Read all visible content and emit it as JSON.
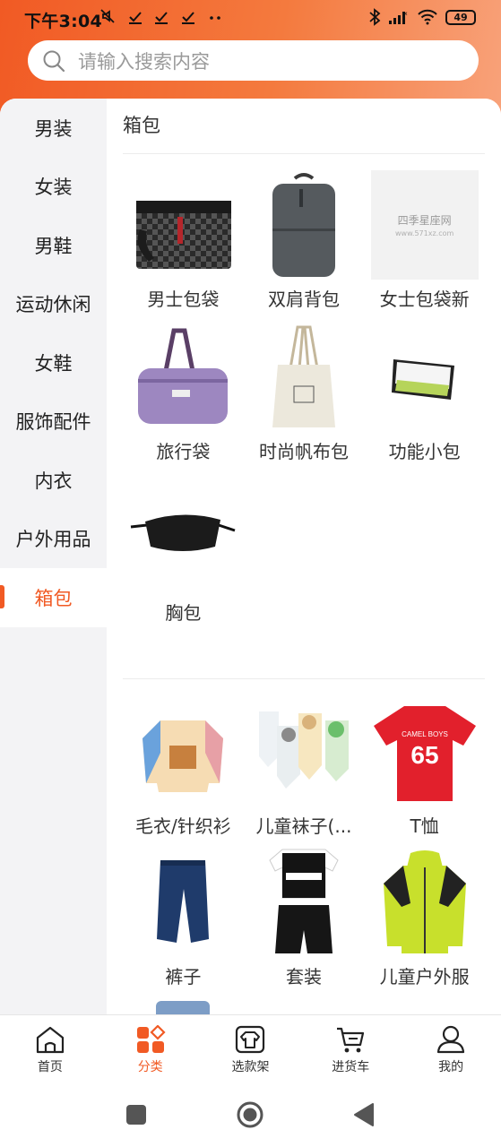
{
  "status_bar": {
    "time": "下午3:04",
    "left_icons": [
      "mute-icon",
      "check-icon",
      "check-icon",
      "check-icon",
      "more-dots-icon"
    ],
    "right_icons": [
      "bluetooth-icon",
      "signal-icon",
      "wifi-icon"
    ],
    "battery": "49"
  },
  "search": {
    "placeholder": "请输入搜索内容"
  },
  "sidebar": {
    "items": [
      {
        "label": "男装"
      },
      {
        "label": "女装"
      },
      {
        "label": "男鞋"
      },
      {
        "label": "运动休闲"
      },
      {
        "label": "女鞋"
      },
      {
        "label": "服饰配件"
      },
      {
        "label": "内衣"
      },
      {
        "label": "户外用品"
      },
      {
        "label": "箱包"
      }
    ],
    "active_index": 8
  },
  "content": {
    "section1": {
      "title": "箱包",
      "products": [
        {
          "label": "男士包袋"
        },
        {
          "label": "双肩背包"
        },
        {
          "label": "女士包袋新",
          "image_text": "四季星座网",
          "image_subtext": "www.571xz.com"
        },
        {
          "label": "旅行袋"
        },
        {
          "label": "时尚帆布包"
        },
        {
          "label": "功能小包"
        },
        {
          "label": "胸包"
        }
      ]
    },
    "section2": {
      "products": [
        {
          "label": "毛衣/针织衫"
        },
        {
          "label": "儿童袜子(..."
        },
        {
          "label": "T恤",
          "image_text_top": "CAMEL BOYS",
          "image_text_num": "65"
        },
        {
          "label": "裤子"
        },
        {
          "label": "套装"
        },
        {
          "label": "儿童户外服"
        }
      ]
    }
  },
  "bottom_nav": {
    "items": [
      {
        "label": "首页",
        "icon": "home-icon"
      },
      {
        "label": "分类",
        "icon": "category-icon"
      },
      {
        "label": "选款架",
        "icon": "shirt-icon"
      },
      {
        "label": "进货车",
        "icon": "cart-icon"
      },
      {
        "label": "我的",
        "icon": "user-icon"
      }
    ],
    "active_index": 1
  },
  "colors": {
    "accent": "#f15a24",
    "sidebar_bg": "#f3f3f5",
    "text": "#333333"
  }
}
